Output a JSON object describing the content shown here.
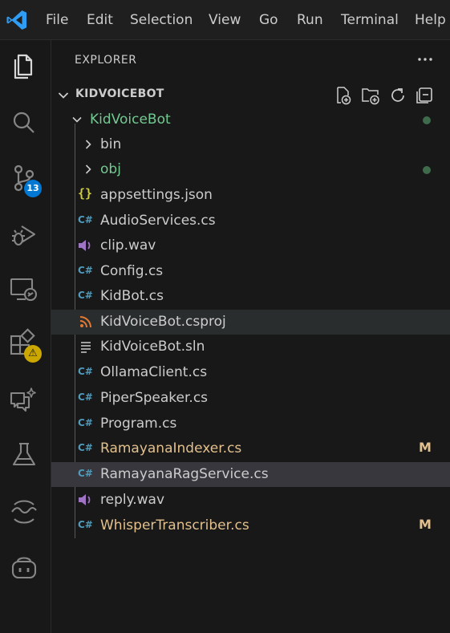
{
  "menu": [
    "File",
    "Edit",
    "Selection",
    "View",
    "Go",
    "Run",
    "Terminal",
    "Help"
  ],
  "activity": {
    "source_control_badge": "13",
    "extensions_badge": "⚠"
  },
  "explorer": {
    "title": "EXPLORER",
    "more": "...",
    "section_title": "KIDVOICEBOT",
    "root_folder": "KidVoiceBot",
    "items": [
      {
        "label": "bin",
        "kind": "folder"
      },
      {
        "label": "obj",
        "kind": "folder"
      },
      {
        "label": "appsettings.json",
        "kind": "json"
      },
      {
        "label": "AudioServices.cs",
        "kind": "cs"
      },
      {
        "label": "clip.wav",
        "kind": "wav"
      },
      {
        "label": "Config.cs",
        "kind": "cs"
      },
      {
        "label": "KidBot.cs",
        "kind": "cs"
      },
      {
        "label": "KidVoiceBot.csproj",
        "kind": "csproj"
      },
      {
        "label": "KidVoiceBot.sln",
        "kind": "sln"
      },
      {
        "label": "OllamaClient.cs",
        "kind": "cs"
      },
      {
        "label": "PiperSpeaker.cs",
        "kind": "cs"
      },
      {
        "label": "Program.cs",
        "kind": "cs"
      },
      {
        "label": "RamayanaIndexer.cs",
        "kind": "cs",
        "status": "M"
      },
      {
        "label": "RamayanaRagService.cs",
        "kind": "cs"
      },
      {
        "label": "reply.wav",
        "kind": "wav"
      },
      {
        "label": "WhisperTranscriber.cs",
        "kind": "cs",
        "status": "M"
      }
    ]
  },
  "colors": {
    "accent_blue": "#0078d4",
    "warning_yellow": "#cca700",
    "git_untracked": "#73c991",
    "git_modified": "#e2c08d",
    "cs_icon": "#519aba",
    "json_icon": "#cbcb41",
    "wav_icon": "#a074c4",
    "csproj_icon": "#e37933"
  }
}
